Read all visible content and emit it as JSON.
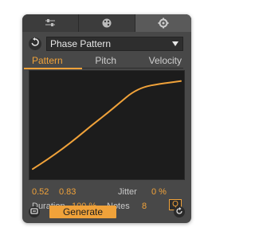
{
  "toolbar": {
    "tabs": [
      {
        "icon": "sliders-icon"
      },
      {
        "icon": "dice-icon"
      },
      {
        "icon": "gear-icon"
      }
    ],
    "active_tab_index": 2
  },
  "preset": {
    "selected": "Phase Pattern"
  },
  "mode_tabs": {
    "items": [
      "Pattern",
      "Pitch",
      "Velocity"
    ],
    "active": "Pattern"
  },
  "curve": {
    "display_values": [
      "0.52",
      "0.83"
    ],
    "points": [
      [
        0.0,
        0.04
      ],
      [
        0.1,
        0.14
      ],
      [
        0.2,
        0.25
      ],
      [
        0.3,
        0.37
      ],
      [
        0.4,
        0.5
      ],
      [
        0.5,
        0.62
      ],
      [
        0.6,
        0.75
      ],
      [
        0.67,
        0.84
      ],
      [
        0.75,
        0.9
      ],
      [
        0.85,
        0.93
      ],
      [
        1.0,
        0.96
      ]
    ]
  },
  "params": {
    "jitter_label": "Jitter",
    "jitter_value": "0 %",
    "duration_label": "Duration",
    "duration_value": "100 %",
    "notes_label": "Notes",
    "notes_value": "8",
    "quantize_label": "Q"
  },
  "bottom": {
    "generate_label": "Generate"
  },
  "colors": {
    "accent": "#f0a23a",
    "panel": "#484848",
    "display_bg": "#1c1c1c"
  }
}
